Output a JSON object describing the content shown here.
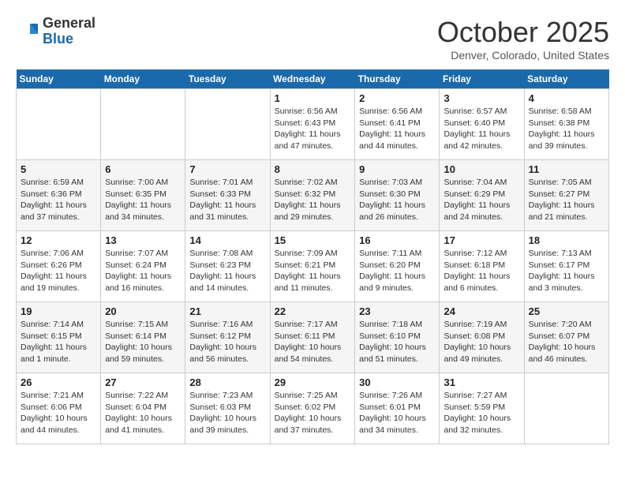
{
  "header": {
    "logo_general": "General",
    "logo_blue": "Blue",
    "month": "October 2025",
    "location": "Denver, Colorado, United States"
  },
  "days_of_week": [
    "Sunday",
    "Monday",
    "Tuesday",
    "Wednesday",
    "Thursday",
    "Friday",
    "Saturday"
  ],
  "weeks": [
    [
      {
        "num": "",
        "info": ""
      },
      {
        "num": "",
        "info": ""
      },
      {
        "num": "",
        "info": ""
      },
      {
        "num": "1",
        "info": "Sunrise: 6:56 AM\nSunset: 6:43 PM\nDaylight: 11 hours and 47 minutes."
      },
      {
        "num": "2",
        "info": "Sunrise: 6:56 AM\nSunset: 6:41 PM\nDaylight: 11 hours and 44 minutes."
      },
      {
        "num": "3",
        "info": "Sunrise: 6:57 AM\nSunset: 6:40 PM\nDaylight: 11 hours and 42 minutes."
      },
      {
        "num": "4",
        "info": "Sunrise: 6:58 AM\nSunset: 6:38 PM\nDaylight: 11 hours and 39 minutes."
      }
    ],
    [
      {
        "num": "5",
        "info": "Sunrise: 6:59 AM\nSunset: 6:36 PM\nDaylight: 11 hours and 37 minutes."
      },
      {
        "num": "6",
        "info": "Sunrise: 7:00 AM\nSunset: 6:35 PM\nDaylight: 11 hours and 34 minutes."
      },
      {
        "num": "7",
        "info": "Sunrise: 7:01 AM\nSunset: 6:33 PM\nDaylight: 11 hours and 31 minutes."
      },
      {
        "num": "8",
        "info": "Sunrise: 7:02 AM\nSunset: 6:32 PM\nDaylight: 11 hours and 29 minutes."
      },
      {
        "num": "9",
        "info": "Sunrise: 7:03 AM\nSunset: 6:30 PM\nDaylight: 11 hours and 26 minutes."
      },
      {
        "num": "10",
        "info": "Sunrise: 7:04 AM\nSunset: 6:29 PM\nDaylight: 11 hours and 24 minutes."
      },
      {
        "num": "11",
        "info": "Sunrise: 7:05 AM\nSunset: 6:27 PM\nDaylight: 11 hours and 21 minutes."
      }
    ],
    [
      {
        "num": "12",
        "info": "Sunrise: 7:06 AM\nSunset: 6:26 PM\nDaylight: 11 hours and 19 minutes."
      },
      {
        "num": "13",
        "info": "Sunrise: 7:07 AM\nSunset: 6:24 PM\nDaylight: 11 hours and 16 minutes."
      },
      {
        "num": "14",
        "info": "Sunrise: 7:08 AM\nSunset: 6:23 PM\nDaylight: 11 hours and 14 minutes."
      },
      {
        "num": "15",
        "info": "Sunrise: 7:09 AM\nSunset: 6:21 PM\nDaylight: 11 hours and 11 minutes."
      },
      {
        "num": "16",
        "info": "Sunrise: 7:11 AM\nSunset: 6:20 PM\nDaylight: 11 hours and 9 minutes."
      },
      {
        "num": "17",
        "info": "Sunrise: 7:12 AM\nSunset: 6:18 PM\nDaylight: 11 hours and 6 minutes."
      },
      {
        "num": "18",
        "info": "Sunrise: 7:13 AM\nSunset: 6:17 PM\nDaylight: 11 hours and 3 minutes."
      }
    ],
    [
      {
        "num": "19",
        "info": "Sunrise: 7:14 AM\nSunset: 6:15 PM\nDaylight: 11 hours and 1 minute."
      },
      {
        "num": "20",
        "info": "Sunrise: 7:15 AM\nSunset: 6:14 PM\nDaylight: 10 hours and 59 minutes."
      },
      {
        "num": "21",
        "info": "Sunrise: 7:16 AM\nSunset: 6:12 PM\nDaylight: 10 hours and 56 minutes."
      },
      {
        "num": "22",
        "info": "Sunrise: 7:17 AM\nSunset: 6:11 PM\nDaylight: 10 hours and 54 minutes."
      },
      {
        "num": "23",
        "info": "Sunrise: 7:18 AM\nSunset: 6:10 PM\nDaylight: 10 hours and 51 minutes."
      },
      {
        "num": "24",
        "info": "Sunrise: 7:19 AM\nSunset: 6:08 PM\nDaylight: 10 hours and 49 minutes."
      },
      {
        "num": "25",
        "info": "Sunrise: 7:20 AM\nSunset: 6:07 PM\nDaylight: 10 hours and 46 minutes."
      }
    ],
    [
      {
        "num": "26",
        "info": "Sunrise: 7:21 AM\nSunset: 6:06 PM\nDaylight: 10 hours and 44 minutes."
      },
      {
        "num": "27",
        "info": "Sunrise: 7:22 AM\nSunset: 6:04 PM\nDaylight: 10 hours and 41 minutes."
      },
      {
        "num": "28",
        "info": "Sunrise: 7:23 AM\nSunset: 6:03 PM\nDaylight: 10 hours and 39 minutes."
      },
      {
        "num": "29",
        "info": "Sunrise: 7:25 AM\nSunset: 6:02 PM\nDaylight: 10 hours and 37 minutes."
      },
      {
        "num": "30",
        "info": "Sunrise: 7:26 AM\nSunset: 6:01 PM\nDaylight: 10 hours and 34 minutes."
      },
      {
        "num": "31",
        "info": "Sunrise: 7:27 AM\nSunset: 5:59 PM\nDaylight: 10 hours and 32 minutes."
      },
      {
        "num": "",
        "info": ""
      }
    ]
  ]
}
